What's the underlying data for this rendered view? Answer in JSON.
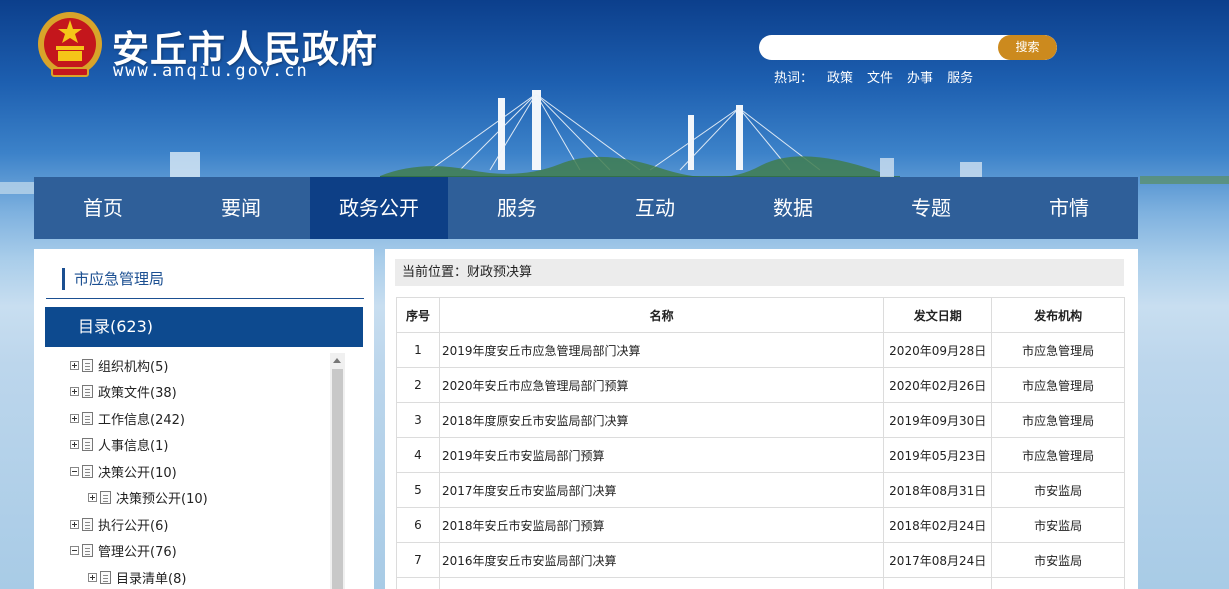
{
  "header": {
    "site_title": "安丘市人民政府",
    "site_url": "www.anqiu.gov.cn",
    "search": {
      "placeholder": "",
      "button_label": "搜索"
    },
    "hotwords_label": "热词：",
    "hotwords": [
      "政策",
      "文件",
      "办事",
      "服务"
    ]
  },
  "nav": {
    "items": [
      "首页",
      "要闻",
      "政务公开",
      "服务",
      "互动",
      "数据",
      "专题",
      "市情"
    ],
    "active": "政务公开"
  },
  "sidebar": {
    "title": "市应急管理局",
    "catalog": "目录(623)",
    "tree": [
      {
        "label": "组织机构(5)",
        "expanded": false,
        "child": false
      },
      {
        "label": "政策文件(38)",
        "expanded": false,
        "child": false
      },
      {
        "label": "工作信息(242)",
        "expanded": false,
        "child": false
      },
      {
        "label": "人事信息(1)",
        "expanded": false,
        "child": false
      },
      {
        "label": "决策公开(10)",
        "expanded": true,
        "child": false
      },
      {
        "label": "决策预公开(10)",
        "expanded": false,
        "child": true
      },
      {
        "label": "执行公开(6)",
        "expanded": false,
        "child": false
      },
      {
        "label": "管理公开(76)",
        "expanded": true,
        "child": false
      },
      {
        "label": "目录清单(8)",
        "expanded": false,
        "child": true
      }
    ]
  },
  "main": {
    "breadcrumb": "当前位置：财政预决算",
    "columns": [
      "序号",
      "名称",
      "发文日期",
      "发布机构"
    ],
    "rows": [
      [
        "1",
        "2019年度安丘市应急管理局部门决算",
        "2020年09月28日",
        "市应急管理局"
      ],
      [
        "2",
        "2020年安丘市应急管理局部门预算",
        "2020年02月26日",
        "市应急管理局"
      ],
      [
        "3",
        "2018年度原安丘市安监局部门决算",
        "2019年09月30日",
        "市应急管理局"
      ],
      [
        "4",
        "2019年安丘市安监局部门预算",
        "2019年05月23日",
        "市应急管理局"
      ],
      [
        "5",
        "2017年度安丘市安监局部门决算",
        "2018年08月31日",
        "市安监局"
      ],
      [
        "6",
        "2018年安丘市安监局部门预算",
        "2018年02月24日",
        "市安监局"
      ],
      [
        "7",
        "2016年度安丘市安监局部门决算",
        "2017年08月24日",
        "市安监局"
      ],
      [
        "",
        "",
        "",
        ""
      ]
    ]
  },
  "colors": {
    "nav_bg": "#2f5f99",
    "nav_active": "#0d3f86",
    "catalog_bar": "#0d4a8f",
    "search_button": "#cc8a1e"
  }
}
